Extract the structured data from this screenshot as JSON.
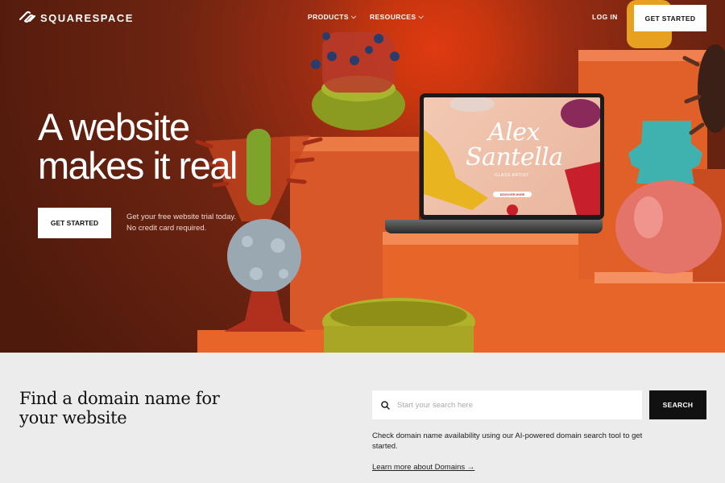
{
  "nav": {
    "logo_text": "SQUARESPACE",
    "products": "PRODUCTS",
    "resources": "RESOURCES",
    "login": "LOG IN",
    "cta": "GET STARTED"
  },
  "hero": {
    "headline": "A website makes it real",
    "cta": "GET STARTED",
    "trial_line1": "Get your free website trial today.",
    "trial_line2": "No credit card required.",
    "laptop": {
      "name": "Alex Santella",
      "subtitle": "GLASS ARTIST",
      "button": "DISCOVER MORE"
    }
  },
  "domain": {
    "title": "Find a domain name for your website",
    "search_placeholder": "Start your search here",
    "search_button": "SEARCH",
    "description": "Check domain name availability using our AI-powered domain search tool to get started.",
    "link": "Learn more about Domains →"
  },
  "colors": {
    "hero_bg": "#6e2411",
    "accent_orange": "#e8652a",
    "button_dark": "#111111"
  }
}
